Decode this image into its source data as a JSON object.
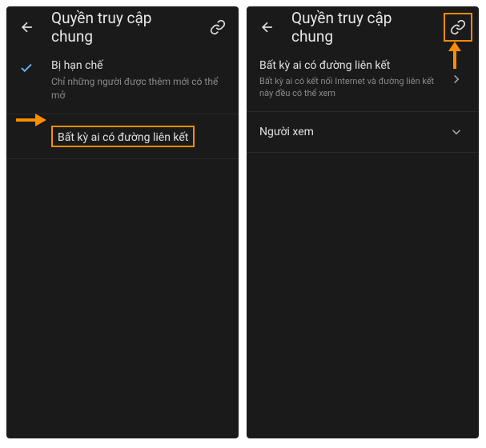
{
  "left": {
    "header": {
      "title": "Quyền truy cập chung"
    },
    "option1": {
      "title": "Bị hạn chế",
      "subtitle": "Chỉ những người được thêm mới có thể mở"
    },
    "option2": {
      "title": "Bất kỳ ai có đường liên kết"
    }
  },
  "right": {
    "header": {
      "title": "Quyền truy cập chung"
    },
    "row1": {
      "title": "Bất kỳ ai có đường liên kết",
      "subtitle": "Bất kỳ ai có kết nối Internet và đường liên kết này đều có thể xem"
    },
    "row2": {
      "title": "Người xem"
    }
  },
  "colors": {
    "highlight": "#ff8c00",
    "bg": "#1a1a1a",
    "text": "#e0e0e0",
    "subtext": "#8a8a8a"
  }
}
